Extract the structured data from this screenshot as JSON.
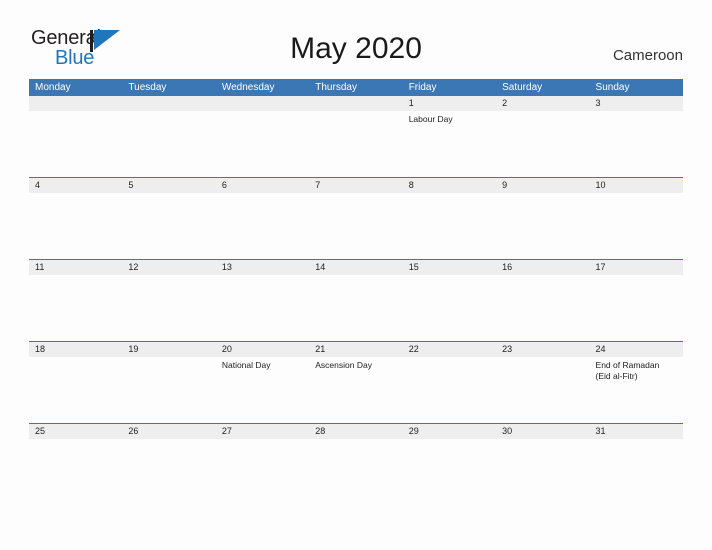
{
  "header": {
    "logo": {
      "word_general": "General",
      "word_blue": "Blue",
      "flag_icon": "flag-triangle-icon",
      "general_color": "#231f20",
      "blue_color": "#1f76bd"
    },
    "title": "May 2020",
    "country": "Cameroon"
  },
  "colors": {
    "header_blue": "#3b77b4",
    "date_band_gray": "#eeeeee",
    "page_background": "#fdfdfd",
    "text_dark": "#222222"
  },
  "calendar": {
    "month": "May",
    "year": "2020",
    "weekday_headers": [
      "Monday",
      "Tuesday",
      "Wednesday",
      "Thursday",
      "Friday",
      "Saturday",
      "Sunday"
    ],
    "weeks": [
      {
        "days": [
          {
            "date": "",
            "event": ""
          },
          {
            "date": "",
            "event": ""
          },
          {
            "date": "",
            "event": ""
          },
          {
            "date": "",
            "event": ""
          },
          {
            "date": "1",
            "event": "Labour Day"
          },
          {
            "date": "2",
            "event": ""
          },
          {
            "date": "3",
            "event": ""
          }
        ]
      },
      {
        "days": [
          {
            "date": "4",
            "event": ""
          },
          {
            "date": "5",
            "event": ""
          },
          {
            "date": "6",
            "event": ""
          },
          {
            "date": "7",
            "event": ""
          },
          {
            "date": "8",
            "event": ""
          },
          {
            "date": "9",
            "event": ""
          },
          {
            "date": "10",
            "event": ""
          }
        ]
      },
      {
        "days": [
          {
            "date": "11",
            "event": ""
          },
          {
            "date": "12",
            "event": ""
          },
          {
            "date": "13",
            "event": ""
          },
          {
            "date": "14",
            "event": ""
          },
          {
            "date": "15",
            "event": ""
          },
          {
            "date": "16",
            "event": ""
          },
          {
            "date": "17",
            "event": ""
          }
        ]
      },
      {
        "days": [
          {
            "date": "18",
            "event": ""
          },
          {
            "date": "19",
            "event": ""
          },
          {
            "date": "20",
            "event": "National Day"
          },
          {
            "date": "21",
            "event": "Ascension Day"
          },
          {
            "date": "22",
            "event": ""
          },
          {
            "date": "23",
            "event": ""
          },
          {
            "date": "24",
            "event": "End of Ramadan\n(Eid al-Fitr)"
          }
        ]
      },
      {
        "days": [
          {
            "date": "25",
            "event": ""
          },
          {
            "date": "26",
            "event": ""
          },
          {
            "date": "27",
            "event": ""
          },
          {
            "date": "28",
            "event": ""
          },
          {
            "date": "29",
            "event": ""
          },
          {
            "date": "30",
            "event": ""
          },
          {
            "date": "31",
            "event": ""
          }
        ]
      }
    ]
  }
}
